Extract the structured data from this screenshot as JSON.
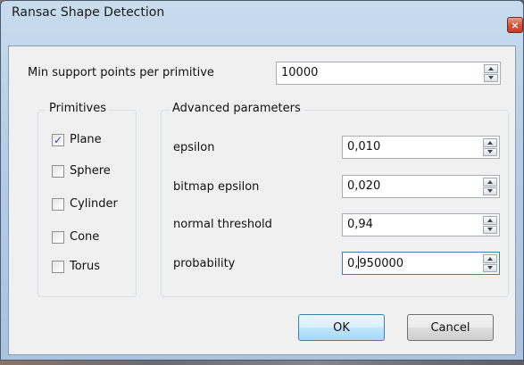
{
  "window": {
    "title": "Ransac Shape Detection",
    "close_glyph": "×"
  },
  "min_support": {
    "label": "Min support points per primitive",
    "value": "10000"
  },
  "primitives": {
    "title": "Primitives",
    "items": [
      {
        "label": "Plane",
        "checked": true,
        "check_glyph": "✓"
      },
      {
        "label": "Sphere",
        "checked": false
      },
      {
        "label": "Cylinder",
        "checked": false
      },
      {
        "label": "Cone",
        "checked": false
      },
      {
        "label": "Torus",
        "checked": false
      }
    ]
  },
  "advanced": {
    "title": "Advanced parameters",
    "epsilon": {
      "label": "epsilon",
      "value": "0,010"
    },
    "bitmap_epsilon": {
      "label": "bitmap epsilon",
      "value": "0,020"
    },
    "normal_threshold": {
      "label": "normal threshold",
      "value": "0,94"
    },
    "probability": {
      "label": "probability",
      "value_before_caret": "0,",
      "value_after_caret": "950000"
    }
  },
  "buttons": {
    "ok": "OK",
    "cancel": "Cancel"
  }
}
